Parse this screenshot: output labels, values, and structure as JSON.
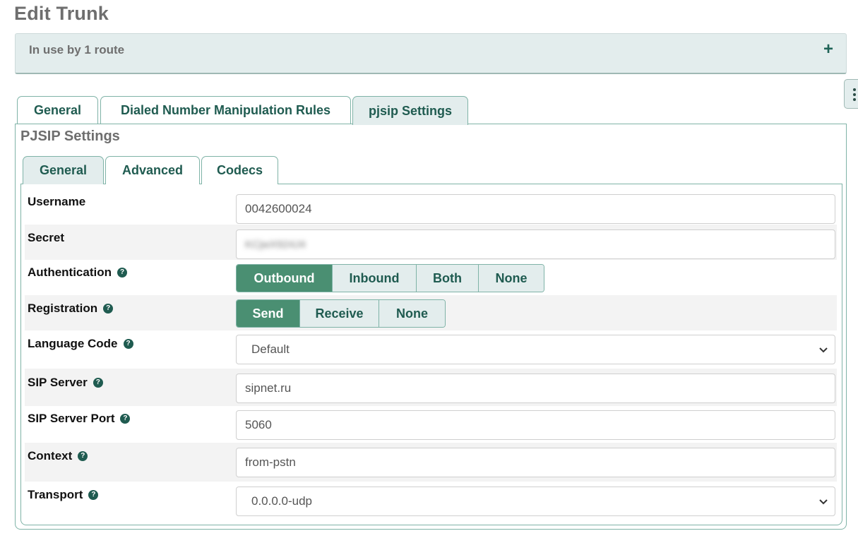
{
  "page": {
    "title": "Edit Trunk"
  },
  "usage_panel": {
    "text": "In use by 1 route",
    "expand_icon": "plus-icon"
  },
  "top_tabs": [
    {
      "label": "General",
      "active": false
    },
    {
      "label": "Dialed Number Manipulation Rules",
      "active": false
    },
    {
      "label": "pjsip Settings",
      "active": true
    }
  ],
  "pjsip": {
    "section_title": "PJSIP Settings",
    "sub_tabs": [
      {
        "label": "General",
        "active": true
      },
      {
        "label": "Advanced",
        "active": false
      },
      {
        "label": "Codecs",
        "active": false
      }
    ],
    "fields": {
      "username": {
        "label": "Username",
        "value": "0042600024"
      },
      "secret": {
        "label": "Secret",
        "value": "KCjwX924J4"
      },
      "authentication": {
        "label": "Authentication",
        "options": [
          "Outbound",
          "Inbound",
          "Both",
          "None"
        ],
        "selected": "Outbound"
      },
      "registration": {
        "label": "Registration",
        "options": [
          "Send",
          "Receive",
          "None"
        ],
        "selected": "Send"
      },
      "language_code": {
        "label": "Language Code",
        "value": "Default"
      },
      "sip_server": {
        "label": "SIP Server",
        "value": "sipnet.ru"
      },
      "sip_server_port": {
        "label": "SIP Server Port",
        "value": "5060"
      },
      "context": {
        "label": "Context",
        "value": "from-pstn"
      },
      "transport": {
        "label": "Transport",
        "value": "0.0.0.0-udp"
      }
    }
  },
  "colors": {
    "accent": "#1f5b50",
    "active_button": "#4a8f72",
    "panel_bg": "#e3eded",
    "border": "#7fb3a7"
  }
}
